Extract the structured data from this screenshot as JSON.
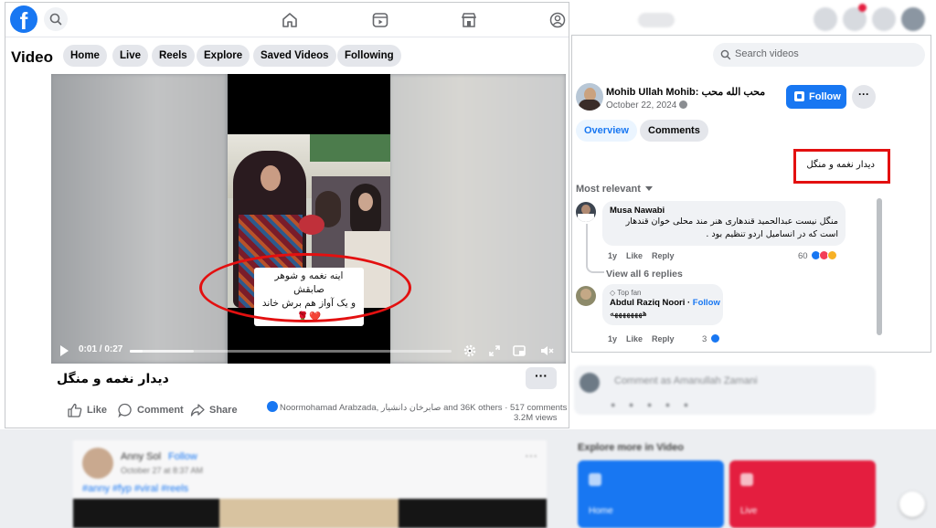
{
  "nav": {
    "logo": "f",
    "icons": [
      "search-icon",
      "home-icon",
      "video-icon",
      "marketplace-icon",
      "profile-icon"
    ]
  },
  "video_header": {
    "title": "Video",
    "tabs": [
      "Home",
      "Live",
      "Reels",
      "Explore",
      "Saved Videos",
      "Following"
    ]
  },
  "player": {
    "caption_line1": "اینه نغمه و شوهر صابقش",
    "caption_line2": "و یک آواز هم برش خاند❤️🌹",
    "current_time": "0:01",
    "duration": "0:27",
    "time_display": "0:01 / 0:27",
    "progress": 0.04,
    "buffered": 0.2
  },
  "post": {
    "title": "دیدار نغمه و منگل",
    "more_label": "···",
    "like_label": "Like",
    "comment_label": "Comment",
    "share_label": "Share",
    "reactors_text": "Noormohamad Arabzada, صابرخان دانشیار and 36K others",
    "comments_count": "517 comments",
    "views": "3.2M views"
  },
  "side": {
    "search_placeholder": "Search videos",
    "author_name": "Mohib Ullah Mohib: محب الله محب",
    "author_date": "October 22, 2024",
    "follow_label": "Follow",
    "more_label": "···",
    "tabs": [
      "Overview",
      "Comments"
    ],
    "description": "دیدار نغمه و منگل",
    "sort_label": "Most relevant",
    "comments": [
      {
        "author": "Musa Nawabi",
        "text_line1": "منگل نیست عبدالحمید قندهاری هنر مند محلی خوان قندهار",
        "text_line2": "است که در انساميل اردو تنظیم بود .",
        "time": "1y",
        "like": "Like",
        "reply": "Reply",
        "reactions": "60"
      },
      {
        "badge": "Top fan",
        "author": "Abdul Raziq Noori",
        "follow": "Follow",
        "text_line1": "ههههههههه",
        "time": "1y",
        "like": "Like",
        "reply": "Reply",
        "reactions": "3"
      }
    ],
    "view_replies": "View all 6 replies"
  },
  "background": {
    "post_author": "Anny Sol",
    "post_follow": "Follow",
    "post_date": "October 27 at 8:37 AM",
    "post_text": "#anny #fyp #viral #reels",
    "composer_placeholder": "Comment as Amanullah Zamani",
    "explore_title": "Explore more in Video",
    "explore_cards": [
      "Home",
      "Live"
    ]
  },
  "colors": {
    "brand": "#1877f2",
    "highlight": "#e31010",
    "chip_bg": "#e4e6eb"
  }
}
